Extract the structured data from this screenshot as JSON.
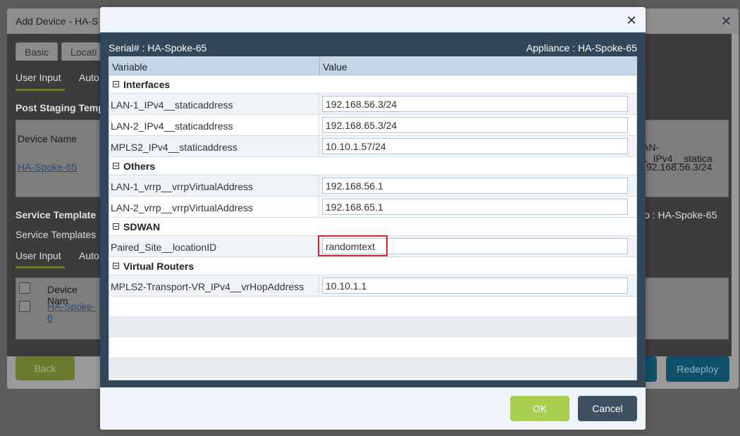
{
  "background": {
    "dialog_title": "Add Device - HA-S",
    "tabs": [
      "Basic",
      "Locati"
    ],
    "subtabs1": [
      "User Input",
      "Auto"
    ],
    "post_staging_label": "Post Staging Temp",
    "grid1": {
      "col1_header": "Device Name",
      "col2_header": "AN-1_IPv4__statica",
      "row_link": "HA-Spoke-65",
      "row_value": "92.168.56.3/24"
    },
    "service_template_label": "Service Template",
    "service_templates_label": "Service Templates",
    "right_label": "o : HA-Spoke-65",
    "subtabs2": [
      "User Input",
      "Auto"
    ],
    "grid2": {
      "col_header": "Device Nam",
      "row_link": "HA-Spoke-6"
    },
    "back_label": "Back",
    "redeploy_label": "Redeploy"
  },
  "modal": {
    "serial": "Serial# : HA-Spoke-65",
    "appliance": "Appliance : HA-Spoke-65",
    "columns": {
      "variable": "Variable",
      "value": "Value"
    },
    "groups": {
      "interfaces": "Interfaces",
      "others": "Others",
      "sdwan": "SDWAN",
      "virtual_routers": "Virtual Routers"
    },
    "rows": {
      "lan1_static": {
        "variable": "LAN-1_IPv4__staticaddress",
        "value": "192.168.56.3/24"
      },
      "lan2_static": {
        "variable": "LAN-2_IPv4__staticaddress",
        "value": "192.168.65.3/24"
      },
      "mpls2_static": {
        "variable": "MPLS2_IPv4__staticaddress",
        "value": "10.10.1.57/24"
      },
      "lan1_vrrp": {
        "variable": "LAN-1_vrrp__vrrpVirtualAddress",
        "value": "192.168.56.1"
      },
      "lan2_vrrp": {
        "variable": "LAN-2_vrrp__vrrpVirtualAddress",
        "value": "192.168.65.1"
      },
      "paired_site": {
        "variable": "Paired_Site__locationID",
        "value": "randomtext"
      },
      "mpls2_vr": {
        "variable": "MPLS2-Transport-VR_IPv4__vrHopAddress",
        "value": "10.10.1.1"
      }
    },
    "ok_label": "OK",
    "cancel_label": "Cancel"
  },
  "colors": {
    "modal_body": "#33475b",
    "header_row": "#c3d5e6",
    "ok_button": "#a8cf4e",
    "cancel_button": "#3d4f60",
    "highlight_border": "#d3262e"
  }
}
